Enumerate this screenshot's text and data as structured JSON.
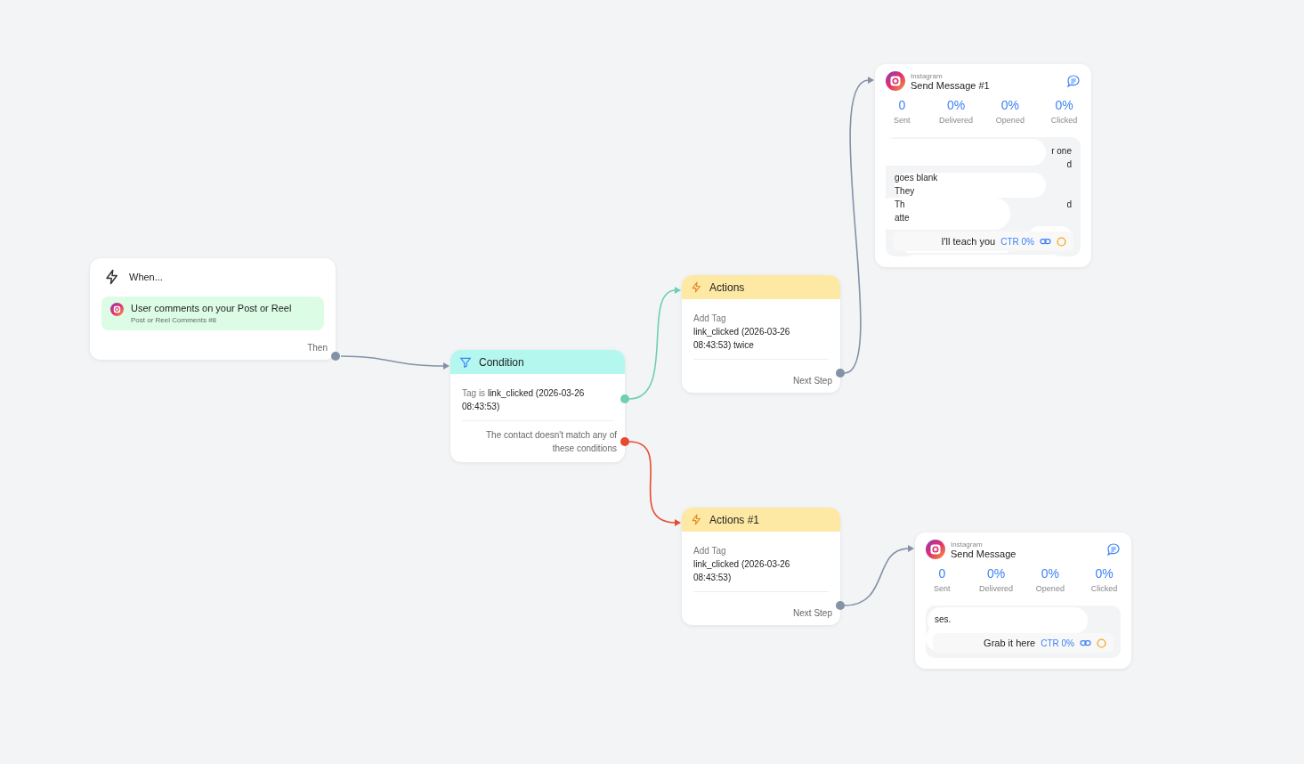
{
  "trigger": {
    "title": "When...",
    "event": {
      "title": "User comments on your Post or Reel",
      "subtitle": "Post or Reel Comments #8"
    },
    "output": "Then"
  },
  "condition": {
    "title": "Condition",
    "rule_prefix": "Tag is",
    "rule_value": "link_clicked (2026-03-26 08:43:53)",
    "fallback": "The contact doesn't match any of these conditions"
  },
  "actions": [
    {
      "title": "Actions",
      "label": "Add Tag",
      "value": "link_clicked (2026-03-26 08:43:53) twice",
      "output": "Next Step"
    },
    {
      "title": "Actions #1",
      "label": "Add Tag",
      "value": "link_clicked (2026-03-26 08:43:53)",
      "output": "Next Step"
    }
  ],
  "messages": [
    {
      "channel": "Instagram",
      "title": "Send Message #1",
      "stats": [
        {
          "value": "0",
          "label": "Sent"
        },
        {
          "value": "0%",
          "label": "Delivered"
        },
        {
          "value": "0%",
          "label": "Opened"
        },
        {
          "value": "0%",
          "label": "Clicked"
        }
      ],
      "preview_lines": [
        {
          "right": "r one"
        },
        {
          "right": "d"
        },
        {
          "left": "goes blank"
        },
        {
          "left": "They"
        },
        {
          "left": "Th",
          "right": "d"
        },
        {
          "left": "atte"
        }
      ],
      "button": {
        "label": "I'll teach you",
        "ctr": "CTR 0%"
      }
    },
    {
      "channel": "Instagram",
      "title": "Send Message",
      "stats": [
        {
          "value": "0",
          "label": "Sent"
        },
        {
          "value": "0%",
          "label": "Delivered"
        },
        {
          "value": "0%",
          "label": "Opened"
        },
        {
          "value": "0%",
          "label": "Clicked"
        }
      ],
      "preview_lines": [
        {
          "left": "ses."
        }
      ],
      "button": {
        "label": "Grab it here",
        "ctr": "CTR 0%"
      }
    }
  ]
}
